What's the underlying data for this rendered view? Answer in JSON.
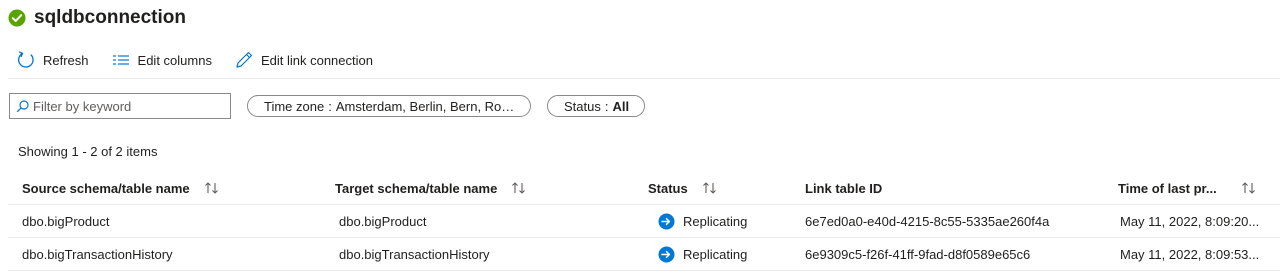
{
  "page": {
    "title": "sqldbconnection",
    "title_status_color": "#57a300"
  },
  "toolbar": {
    "refresh_label": "Refresh",
    "edit_columns_label": "Edit columns",
    "edit_link_label": "Edit link connection",
    "icon_color": "#0078d4"
  },
  "filters": {
    "search_placeholder": "Filter by keyword",
    "timezone_label": "Time zone",
    "timezone_value": "Amsterdam, Berlin, Bern, Rome, St...",
    "status_label": "Status",
    "status_value": "All"
  },
  "summary": {
    "showing_text": "Showing 1 - 2 of 2 items"
  },
  "table": {
    "headers": {
      "source": "Source schema/table name",
      "target": "Target schema/table name",
      "status": "Status",
      "link_id": "Link table ID",
      "last_processed": "Time of last pr..."
    },
    "rows": [
      {
        "source": "dbo.bigProduct",
        "target": "dbo.bigProduct",
        "status": "Replicating",
        "link_id": "6e7ed0a0-e40d-4215-8c55-5335ae260f4a",
        "last_processed": "May 11, 2022, 8:09:20..."
      },
      {
        "source": "dbo.bigTransactionHistory",
        "target": "dbo.bigTransactionHistory",
        "status": "Replicating",
        "link_id": "6e9309c5-f26f-41ff-9fad-d8f0589e65c6",
        "last_processed": "May 11, 2022, 8:09:53..."
      }
    ],
    "status_icon_color": "#0078d4"
  }
}
